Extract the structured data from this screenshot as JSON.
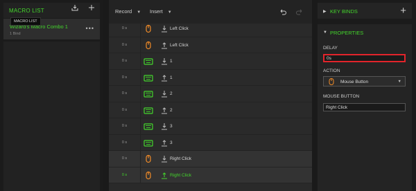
{
  "colors": {
    "accent": "#44d62c",
    "highlight": "#e3242b"
  },
  "macro_list": {
    "title": "MACRO LIST",
    "tooltip": "MACRO LIST",
    "item": {
      "name": "Wizard's Macro Combo 1",
      "sub": "1 Bind",
      "more": "•••"
    }
  },
  "toolbar": {
    "record_label": "Record",
    "insert_label": "Insert"
  },
  "events": [
    {
      "delay": "0 s",
      "icon": "mouse-icon",
      "dir": "down",
      "label": "Left Click"
    },
    {
      "delay": "0 s",
      "icon": "mouse-icon",
      "dir": "up",
      "label": "Left Click"
    },
    {
      "delay": "0 s",
      "icon": "keyboard-icon",
      "dir": "down",
      "label": "1"
    },
    {
      "delay": "0 s",
      "icon": "keyboard-icon",
      "dir": "up",
      "label": "1"
    },
    {
      "delay": "0 s",
      "icon": "keyboard-icon",
      "dir": "down",
      "label": "2"
    },
    {
      "delay": "0 s",
      "icon": "keyboard-icon",
      "dir": "up",
      "label": "2"
    },
    {
      "delay": "0 s",
      "icon": "keyboard-icon",
      "dir": "down",
      "label": "3"
    },
    {
      "delay": "0 s",
      "icon": "keyboard-icon",
      "dir": "up",
      "label": "3"
    },
    {
      "delay": "0 s",
      "icon": "mouse-icon",
      "dir": "down",
      "label": "Right Click"
    },
    {
      "delay": "0 s",
      "icon": "mouse-icon",
      "dir": "up",
      "label": "Right Click",
      "state": "selected"
    }
  ],
  "key_binds": {
    "title": "KEY BINDS"
  },
  "properties": {
    "title": "PROPERTIES",
    "delay_label": "DELAY",
    "delay_value": "0s",
    "action_label": "ACTION",
    "action_value": "Mouse Button",
    "mouse_button_label": "MOUSE BUTTON",
    "mouse_button_value": "Right Click"
  }
}
